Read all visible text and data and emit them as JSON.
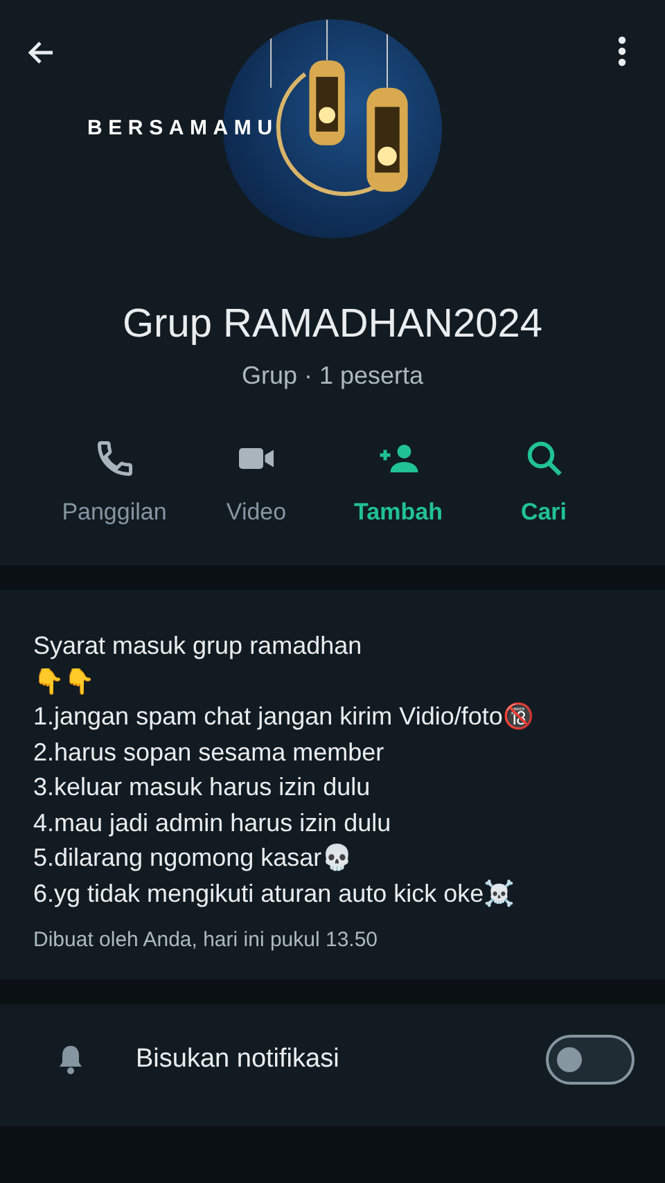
{
  "header": {
    "overlay_caption": "BERSAMAMU",
    "group_name": "Grup RAMADHAN2024",
    "subtitle": "Grup · 1 peserta"
  },
  "actions": [
    {
      "kind": "call",
      "label": "Panggilan",
      "disabled": true
    },
    {
      "kind": "video",
      "label": "Video",
      "disabled": true
    },
    {
      "kind": "add",
      "label": "Tambah",
      "disabled": false
    },
    {
      "kind": "search",
      "label": "Cari",
      "disabled": false
    }
  ],
  "description": {
    "text": "Syarat masuk grup ramadhan\n👇👇\n1.jangan spam chat jangan kirim Vidio/foto🔞\n2.harus sopan sesama member\n3.keluar masuk harus izin dulu\n4.mau jadi admin harus izin dulu\n5.dilarang ngomong kasar💀\n6.yg tidak mengikuti aturan auto kick oke☠️",
    "meta": "Dibuat oleh Anda, hari ini pukul 13.50"
  },
  "settings": [
    {
      "label": "Bisukan notifikasi",
      "on": false
    }
  ]
}
